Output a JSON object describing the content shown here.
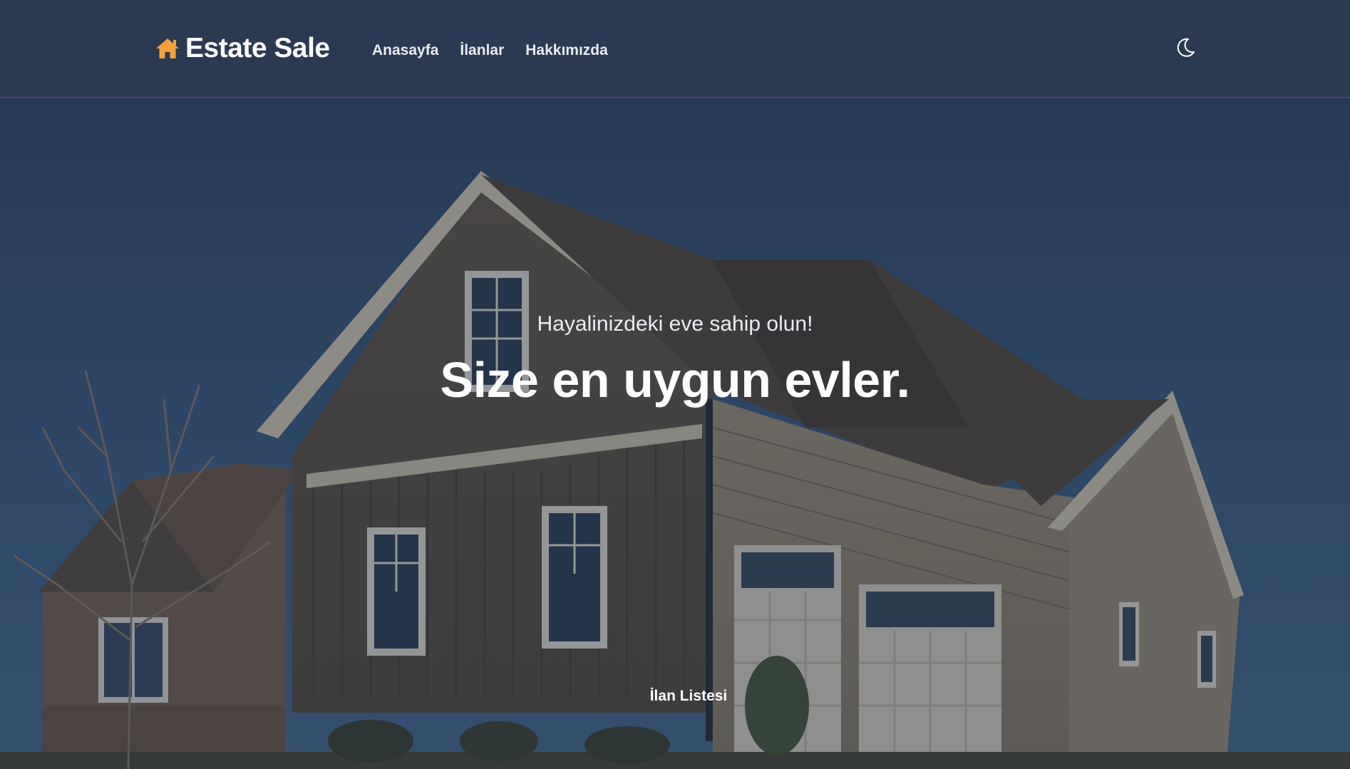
{
  "navbar": {
    "brand_name": "Estate Sale",
    "brand_icon": "home-icon",
    "brand_icon_color": "#f5a03a",
    "links": [
      {
        "label": "Anasayfa"
      },
      {
        "label": "İlanlar"
      },
      {
        "label": "Hakkımızda"
      }
    ],
    "theme_toggle_icon": "moon-icon"
  },
  "hero": {
    "subtitle": "Hayalinizdeki eve sahip olun!",
    "title": "Size en uygun evler.",
    "listing_link": "İlan Listesi",
    "background": "house-photo"
  }
}
